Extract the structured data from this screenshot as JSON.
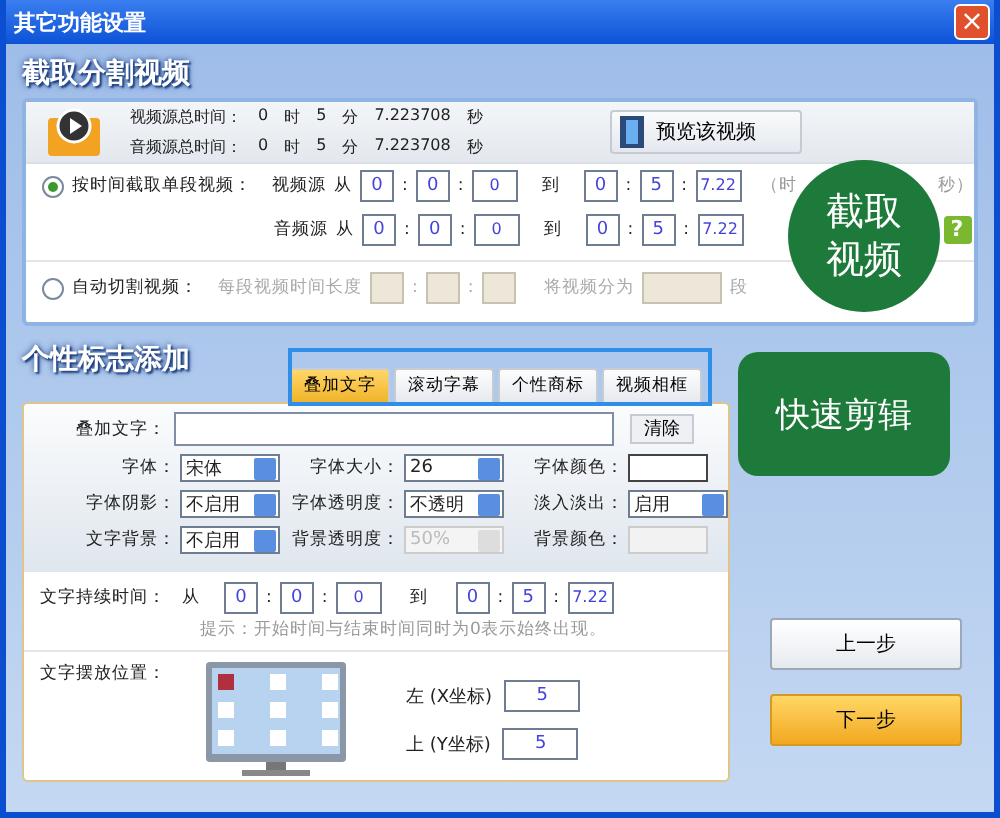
{
  "window": {
    "title": "其它功能设置",
    "close": "×"
  },
  "clip_section": {
    "title": "截取分割视频",
    "summaries": [
      {
        "parts": [
          "视频源总时间：",
          "0",
          "时",
          "5",
          "分",
          "7.223708",
          "秒"
        ]
      },
      {
        "parts": [
          "音频源总时间：",
          "0",
          "时",
          "5",
          "分",
          "7.223708",
          "秒"
        ]
      }
    ],
    "preview_button": "预览该视频",
    "time_separator": ":",
    "modes": [
      {
        "kind": "range",
        "label": "按时间截取单段视频：",
        "selected": true,
        "hint_start": "（时",
        "hint_end": "秒）",
        "help": "?",
        "rows": [
          {
            "source": "视频源",
            "from": "从",
            "start": [
              "0",
              "0",
              "0"
            ],
            "to": "到",
            "end": [
              "0",
              "5",
              "7.22"
            ]
          },
          {
            "source": "音频源",
            "from": "从",
            "start": [
              "0",
              "0",
              "0"
            ],
            "to": "到",
            "end": [
              "0",
              "5",
              "7.22"
            ]
          }
        ]
      },
      {
        "kind": "auto",
        "label": "自动切割视频：",
        "selected": false,
        "length_label": "每段视频时间长度",
        "split_label": "将视频分为",
        "unit": "段"
      }
    ]
  },
  "logo_section": {
    "title": "个性标志添加",
    "tabs": [
      {
        "label": "叠加文字",
        "selected": true
      },
      {
        "label": "滚动字幕",
        "selected": false
      },
      {
        "label": "个性商标",
        "selected": false
      },
      {
        "label": "视频相框",
        "selected": false
      }
    ],
    "overlay_text": {
      "label": "叠加文字：",
      "clear": "清除"
    },
    "settings": [
      {
        "kind": "select",
        "label": "字体：",
        "value": "宋体",
        "disabled": false
      },
      {
        "kind": "select",
        "label": "字体大小：",
        "value": "26",
        "disabled": false
      },
      {
        "kind": "color",
        "label": "字体颜色：",
        "disabled": false
      },
      {
        "kind": "select",
        "label": "字体阴影：",
        "value": "不启用",
        "disabled": false
      },
      {
        "kind": "select",
        "label": "字体透明度：",
        "value": "不透明",
        "disabled": false
      },
      {
        "kind": "select",
        "label": "淡入淡出：",
        "value": "启用",
        "disabled": false
      },
      {
        "kind": "select",
        "label": "文字背景：",
        "value": "不启用",
        "disabled": false
      },
      {
        "kind": "select",
        "label": "背景透明度：",
        "value": "50%",
        "disabled": true
      },
      {
        "kind": "color",
        "label": "背景颜色：",
        "disabled": true
      }
    ],
    "duration": {
      "label": "文字持续时间：",
      "from": "从",
      "start": [
        "0",
        "0",
        "0"
      ],
      "to": "到",
      "end": [
        "0",
        "5",
        "7.22"
      ],
      "hint": "提示：开始时间与结束时间同时为0表示始终出现。"
    },
    "position": {
      "label": "文字摆放位置：",
      "cells": [
        {
          "selected": true
        },
        {
          "selected": false
        },
        {
          "selected": false
        },
        {
          "selected": false
        },
        {
          "selected": false
        },
        {
          "selected": false
        },
        {
          "selected": false
        },
        {
          "selected": false
        },
        {
          "selected": false
        }
      ],
      "left_label": "左 (X坐标)",
      "left_value": "5",
      "top_label": "上 (Y坐标)",
      "top_value": "5"
    }
  },
  "buttons": [
    {
      "kind": "secondary",
      "label": "上一步"
    },
    {
      "kind": "primary",
      "label": "下一步"
    }
  ],
  "callouts": [
    {
      "kind": "circle",
      "text": "截取视频"
    },
    {
      "kind": "bubble",
      "text": "快速剪辑"
    }
  ]
}
